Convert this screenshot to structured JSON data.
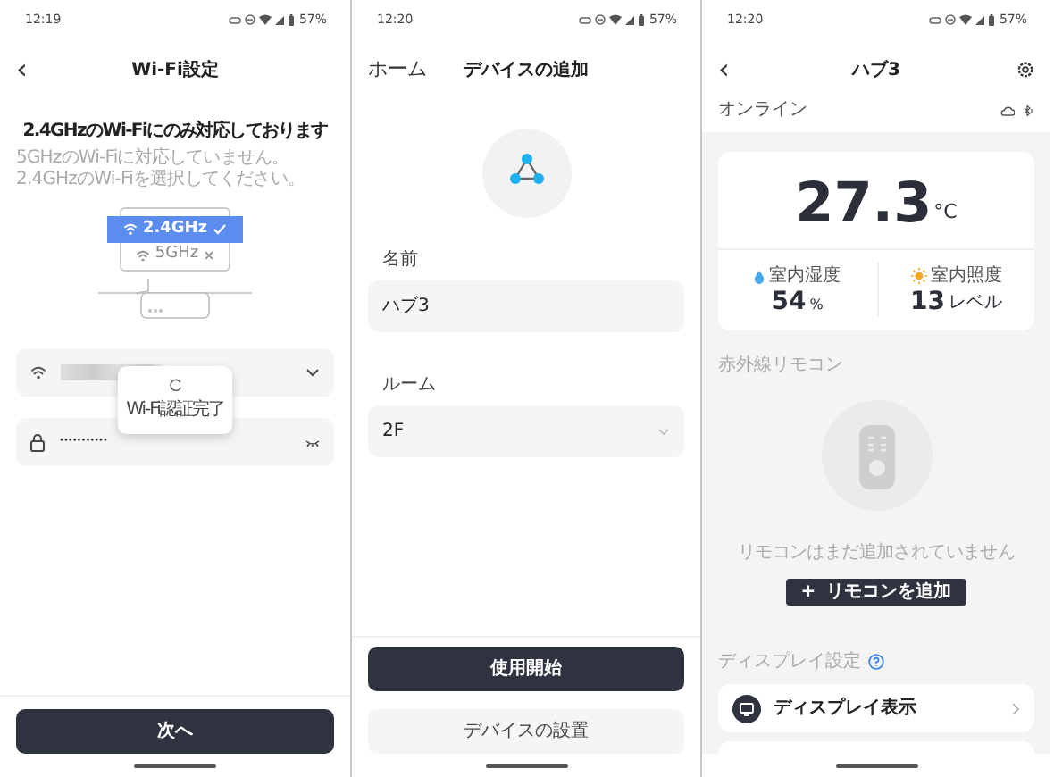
{
  "panels": [
    {
      "kind": "wifi",
      "status_bar": {
        "time": "12:19",
        "battery": "57%"
      },
      "header": {
        "back": "‹",
        "title": "Wi-Fi設定"
      },
      "heading": "2.4GHzのWi-Fiにのみ対応しております",
      "note": "5GHzのWi-Fiに対応していません。2.4GHzのWi-Fiを選択してください。",
      "bands": [
        {
          "label": "2.4GHz",
          "selected": true
        },
        {
          "label": "5GHz",
          "selected": false
        }
      ],
      "password": {
        "value": "•••••••••••"
      },
      "toast": {
        "text": "Wi-Fi認証完了"
      },
      "button": "次へ"
    },
    {
      "kind": "add_device",
      "status_bar": {
        "time": "12:20",
        "battery": "57%"
      },
      "header": {
        "back": "ホーム",
        "title": "デバイスの追加"
      },
      "fields": [
        {
          "label": "名前",
          "value": "ハブ3",
          "kind": "text"
        },
        {
          "label": "ルーム",
          "value": "2F",
          "kind": "select"
        }
      ],
      "buttons": [
        {
          "label": "使用開始",
          "primary": true
        },
        {
          "label": "デバイスの設置",
          "primary": false
        }
      ]
    },
    {
      "kind": "hub",
      "status_bar": {
        "time": "12:20",
        "battery": "57%"
      },
      "header": {
        "back": "‹",
        "title": "ハブ3"
      },
      "status": "オンライン",
      "temperature": {
        "value": "27.3",
        "unit": "°C"
      },
      "stats": [
        {
          "kind": "humidity",
          "label": "室内湿度",
          "value": "54",
          "unit": "%"
        },
        {
          "kind": "light",
          "label": "室内照度",
          "value": "13",
          "unit": "レベル"
        }
      ],
      "remote_section": {
        "title": "赤外線リモコン",
        "empty_text": "リモコンはまだ追加されていません",
        "button_icon": "+",
        "button": "リモコンを追加"
      },
      "display_section": {
        "title": "ディスプレイ設定",
        "items": [
          {
            "label": "ディスプレイ表示"
          }
        ]
      }
    }
  ]
}
